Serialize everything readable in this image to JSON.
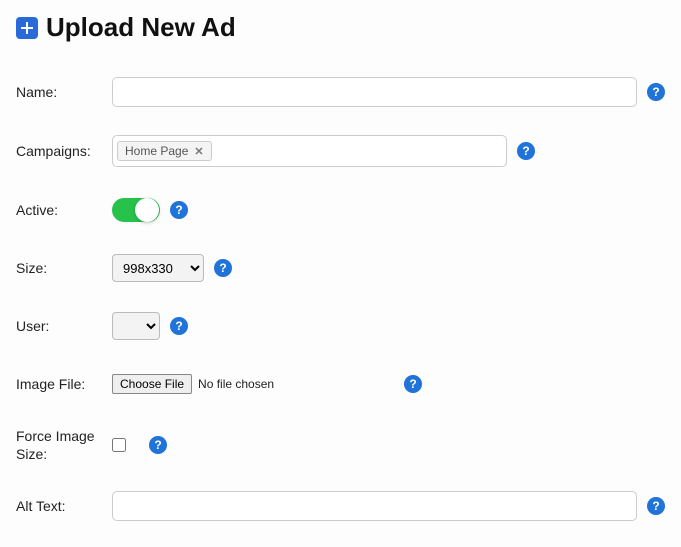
{
  "header": {
    "title": "Upload New Ad"
  },
  "labels": {
    "name": "Name:",
    "campaigns": "Campaigns:",
    "active": "Active:",
    "size": "Size:",
    "user": "User:",
    "imageFile": "Image File:",
    "forceImageSize": "Force Image Size:",
    "altText": "Alt Text:"
  },
  "fields": {
    "name": "",
    "campaign_tag": "Home Page",
    "active": true,
    "size_selected": "998x330",
    "user_selected": "",
    "file_button": "Choose File",
    "file_status": "No file chosen",
    "force_image_size": false,
    "alt_text": ""
  },
  "help_glyph": "?"
}
